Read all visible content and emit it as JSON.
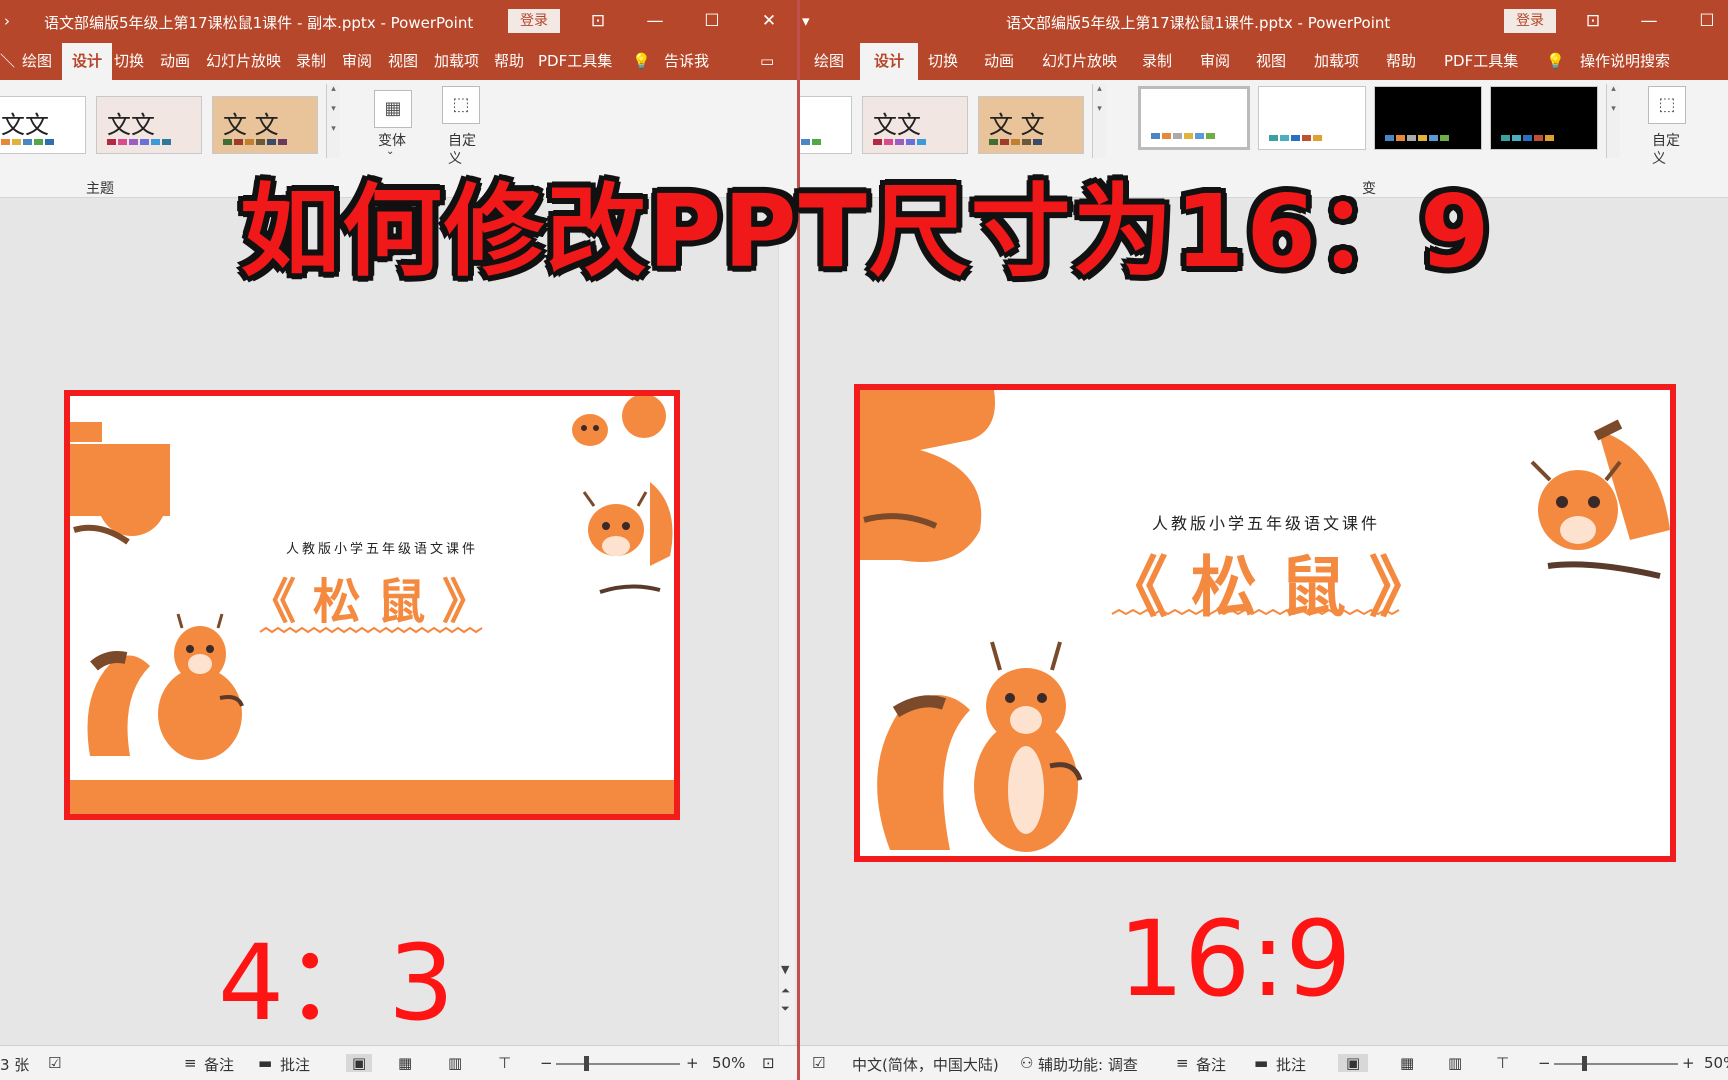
{
  "overlay_title": "如何修改PPT尺寸为16：9",
  "left": {
    "title": "语文部编版5年级上第17课松鼠1课件 - 副本.pptx  -  PowerPoint",
    "login": "登录",
    "tabs": [
      "绘图",
      "设计",
      "切换",
      "动画",
      "幻灯片放映",
      "录制",
      "审阅",
      "视图",
      "加载项",
      "帮助",
      "PDF工具集"
    ],
    "tell_me": "告诉我",
    "theme_group_label": "主题",
    "variant_label": "变体",
    "custom_label": "自定\n义",
    "custom_label_l1": "自定",
    "custom_label_l2": "义",
    "theme_sample_text": "文文",
    "theme_sample_text3": "文 文",
    "slide_subtitle": "人教版小学五年级语文课件",
    "slide_title": "《 松 鼠 》",
    "ratio_label": "4：3",
    "status": {
      "slide_count": "3 张",
      "notes": "备注",
      "comments": "批注",
      "zoom": "50%"
    }
  },
  "right": {
    "title": "语文部编版5年级上第17课松鼠1课件.pptx  -  PowerPoint",
    "login": "登录",
    "tabs": [
      "绘图",
      "设计",
      "切换",
      "动画",
      "幻灯片放映",
      "录制",
      "审阅",
      "视图",
      "加载项",
      "帮助",
      "PDF工具集"
    ],
    "tell_me": "操作说明搜索",
    "variant_label": "变",
    "custom_label_l1": "自定",
    "custom_label_l2": "义",
    "theme_sample_text": "文文",
    "theme_sample_text3": "文 文",
    "slide_subtitle": "人教版小学五年级语文课件",
    "slide_title": "《 松 鼠 》",
    "ratio_label": "16:9",
    "status": {
      "language": "中文(简体，中国大陆)",
      "accessibility": "辅助功能: 调查",
      "notes": "备注",
      "comments": "批注",
      "zoom": "50%"
    }
  },
  "colors": {
    "accent": "#b7472a",
    "ribbon": "#f3f3f3",
    "slide_orange": "#f48a3f",
    "highlight_red": "#f21c1c"
  }
}
